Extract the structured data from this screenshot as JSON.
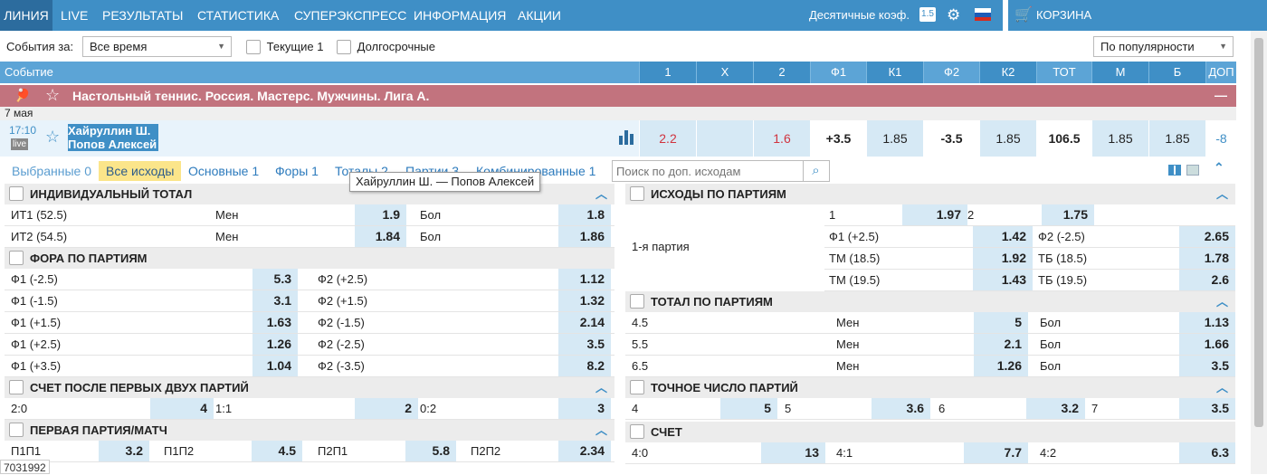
{
  "nav": {
    "items": [
      "ЛИНИЯ",
      "LIVE",
      "РЕЗУЛЬТАТЫ",
      "СТАТИСТИКА",
      "СУПЕРЭКСПРЕСС",
      "ИНФОРМАЦИЯ",
      "АКЦИИ"
    ],
    "decimal_label": "Десятичные коэф.",
    "decimal_badge": "1.5",
    "cart_label": "КОРЗИНА"
  },
  "filter": {
    "events_label": "События за:",
    "period_value": "Все время",
    "current_label": "Текущие 1",
    "longterm_label": "Долгосрочные",
    "sort_value": "По популярности"
  },
  "table_header": {
    "event_label": "Событие",
    "columns": [
      "1",
      "X",
      "2",
      "Ф1",
      "К1",
      "Ф2",
      "К2",
      "ТОТ",
      "М",
      "Б",
      "ДОП"
    ]
  },
  "league": {
    "title": "Настольный теннис. Россия. Мастерс. Мужчины. Лига А.",
    "collapse": "—"
  },
  "date": "7 мая",
  "event": {
    "time": "17:10",
    "live_badge": "live",
    "player1": "Хайруллин Ш.",
    "player2": "Попов Алексей",
    "odds": [
      "2.2",
      "",
      "1.6",
      "+3.5",
      "1.85",
      "-3.5",
      "1.85",
      "106.5",
      "1.85",
      "1.85",
      "-8"
    ]
  },
  "tabs": {
    "items": [
      "Выбранные 0",
      "Все исходы",
      "Основные 1",
      "Форы 1",
      "Тоталы 2",
      "Партии 3",
      "Комбинированные 1"
    ],
    "search_placeholder": "Поиск по доп. исходам"
  },
  "tooltip": "Хайруллин Ш. — Попов Алексей",
  "footer_id": "7031992",
  "markets": {
    "ind_total": {
      "title": "ИНДИВИДУАЛЬНЫЙ ТОТАЛ",
      "rows": [
        {
          "name": "ИТ1 (52.5)",
          "l1": "Мен",
          "v1": "1.9",
          "l2": "Бол",
          "v2": "1.8"
        },
        {
          "name": "ИТ2 (54.5)",
          "l1": "Мен",
          "v1": "1.84",
          "l2": "Бол",
          "v2": "1.86"
        }
      ]
    },
    "fora_parties": {
      "title": "ФОРА ПО ПАРТИЯМ",
      "rows": [
        {
          "l1": "Ф1 (-2.5)",
          "v1": "5.3",
          "l2": "Ф2 (+2.5)",
          "v2": "1.12"
        },
        {
          "l1": "Ф1 (-1.5)",
          "v1": "3.1",
          "l2": "Ф2 (+1.5)",
          "v2": "1.32"
        },
        {
          "l1": "Ф1 (+1.5)",
          "v1": "1.63",
          "l2": "Ф2 (-1.5)",
          "v2": "2.14"
        },
        {
          "l1": "Ф1 (+2.5)",
          "v1": "1.26",
          "l2": "Ф2 (-2.5)",
          "v2": "3.5"
        },
        {
          "l1": "Ф1 (+3.5)",
          "v1": "1.04",
          "l2": "Ф2 (-3.5)",
          "v2": "8.2"
        }
      ]
    },
    "score_two": {
      "title": "СЧЕТ ПОСЛЕ ПЕРВЫХ ДВУХ ПАРТИЙ",
      "row": [
        {
          "l": "2:0",
          "v": "4"
        },
        {
          "l": "1:1",
          "v": "2"
        },
        {
          "l": "0:2",
          "v": "3"
        }
      ]
    },
    "first_match": {
      "title": "ПЕРВАЯ ПАРТИЯ/МАТЧ",
      "row": [
        {
          "l": "П1П1",
          "v": "3.2"
        },
        {
          "l": "П1П2",
          "v": "4.5"
        },
        {
          "l": "П2П1",
          "v": "5.8"
        },
        {
          "l": "П2П2",
          "v": "2.34"
        }
      ]
    },
    "outcomes_parties": {
      "title": "ИСХОДЫ ПО ПАРТИЯМ",
      "party_label": "1-я партия",
      "top": [
        {
          "l": "1",
          "v": "1.97"
        },
        {
          "l": "2",
          "v": "1.75"
        }
      ],
      "rows": [
        {
          "l1": "Ф1 (+2.5)",
          "v1": "1.42",
          "l2": "Ф2 (-2.5)",
          "v2": "2.65"
        },
        {
          "l1": "ТМ (18.5)",
          "v1": "1.92",
          "l2": "ТБ (18.5)",
          "v2": "1.78"
        },
        {
          "l1": "ТМ (19.5)",
          "v1": "1.43",
          "l2": "ТБ (19.5)",
          "v2": "2.6"
        }
      ]
    },
    "total_parties": {
      "title": "ТОТАЛ ПО ПАРТИЯМ",
      "rows": [
        {
          "name": "4.5",
          "l1": "Мен",
          "v1": "5",
          "l2": "Бол",
          "v2": "1.13"
        },
        {
          "name": "5.5",
          "l1": "Мен",
          "v1": "2.1",
          "l2": "Бол",
          "v2": "1.66"
        },
        {
          "name": "6.5",
          "l1": "Мен",
          "v1": "1.26",
          "l2": "Бол",
          "v2": "3.5"
        }
      ]
    },
    "exact_parties": {
      "title": "ТОЧНОЕ ЧИСЛО ПАРТИЙ",
      "row": [
        {
          "l": "4",
          "v": "5"
        },
        {
          "l": "5",
          "v": "3.6"
        },
        {
          "l": "6",
          "v": "3.2"
        },
        {
          "l": "7",
          "v": "3.5"
        }
      ]
    },
    "score": {
      "title": "СЧЕТ",
      "row": [
        {
          "l": "4:0",
          "v": "13"
        },
        {
          "l": "4:1",
          "v": "7.7"
        },
        {
          "l": "4:2",
          "v": "6.3"
        }
      ]
    }
  }
}
